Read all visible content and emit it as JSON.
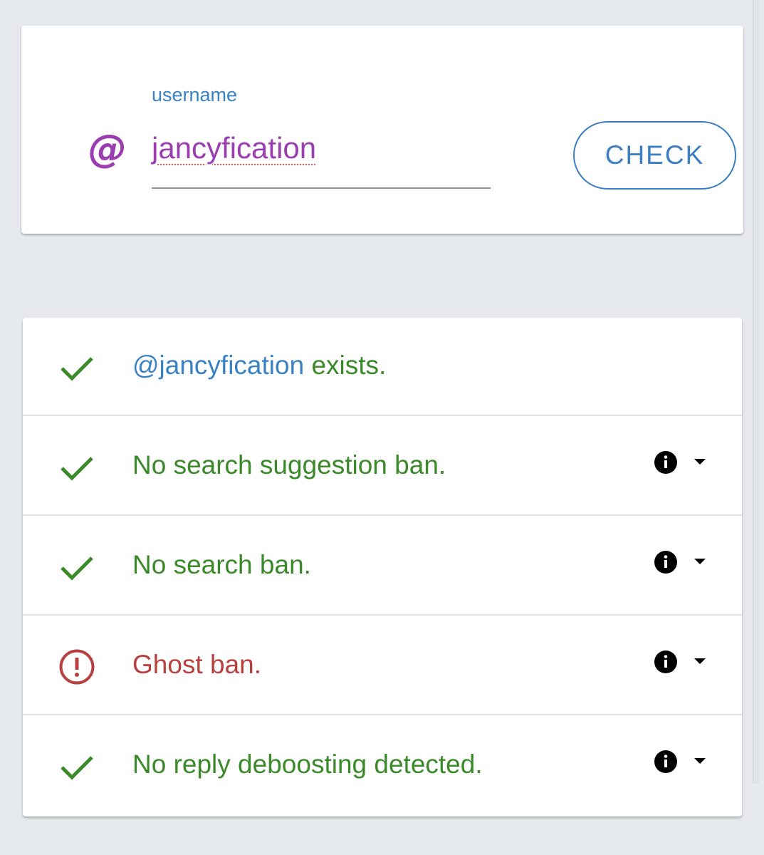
{
  "search": {
    "label": "username",
    "value": "jancyfication",
    "at_symbol": "@",
    "button_label": "CHECK"
  },
  "results": [
    {
      "status": "ok",
      "handle": "@jancyfication",
      "text": " exists.",
      "has_info": false
    },
    {
      "status": "ok",
      "text": "No search suggestion ban.",
      "has_info": true
    },
    {
      "status": "ok",
      "text": "No search ban.",
      "has_info": true
    },
    {
      "status": "alert",
      "text": "Ghost ban.",
      "has_info": true
    },
    {
      "status": "ok",
      "text": "No reply deboosting detected.",
      "has_info": true
    }
  ],
  "colors": {
    "ok": "#3a8a2a",
    "alert": "#b84040",
    "accent": "#3b82c4",
    "username": "#9a3db0"
  }
}
